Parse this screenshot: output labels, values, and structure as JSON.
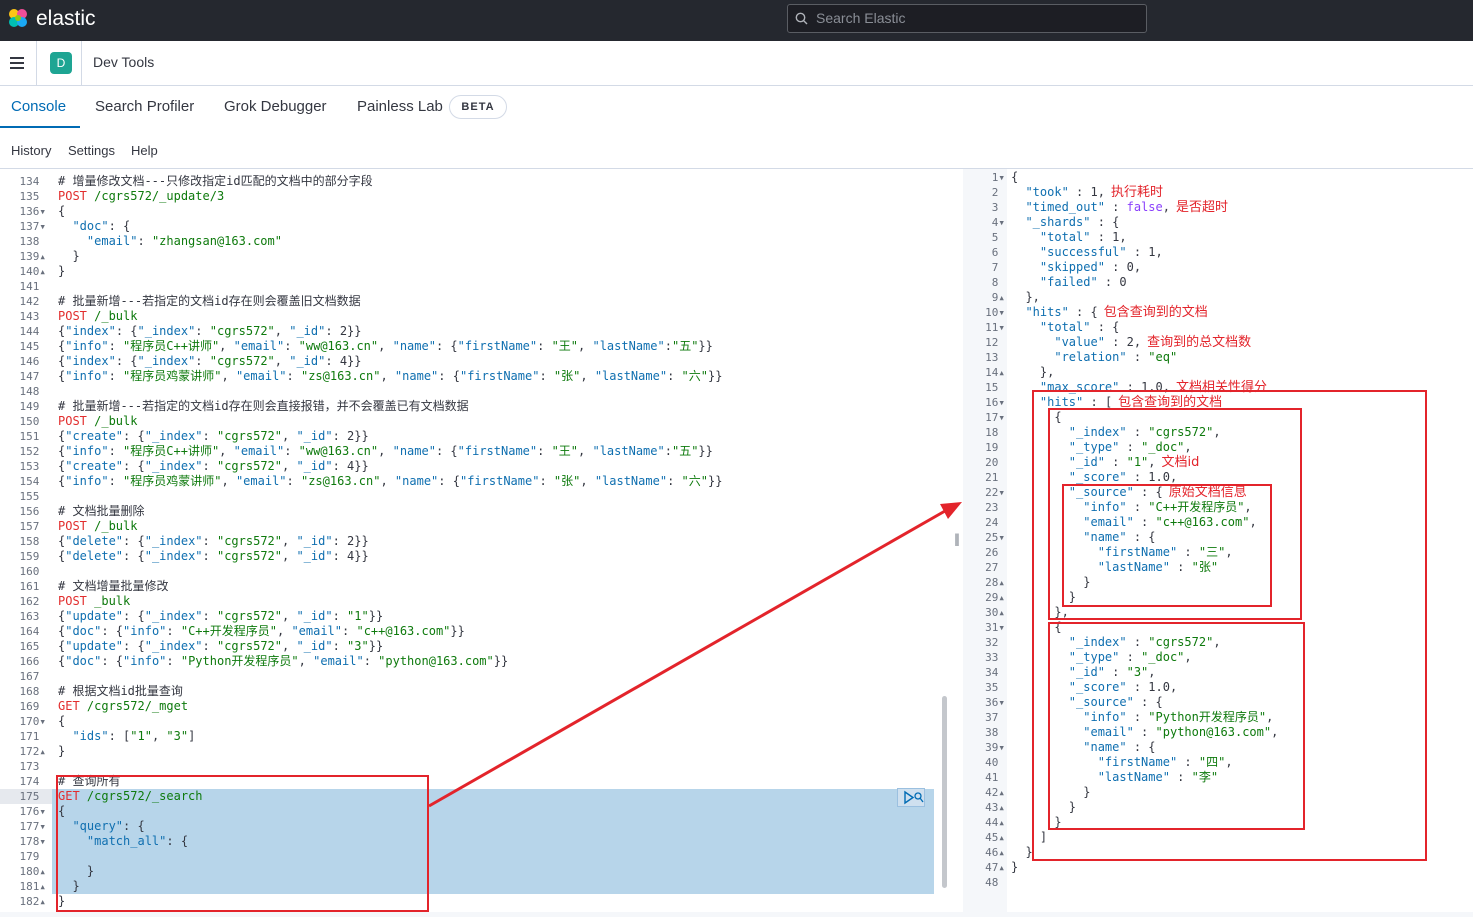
{
  "brand": {
    "name": "elastic"
  },
  "search": {
    "placeholder": "Search Elastic"
  },
  "header": {
    "space_initial": "D",
    "breadcrumb": "Dev Tools"
  },
  "tabs": [
    {
      "label": "Console",
      "active": true
    },
    {
      "label": "Search Profiler"
    },
    {
      "label": "Grok Debugger"
    },
    {
      "label": "Painless Lab",
      "badge": "BETA"
    }
  ],
  "menu": [
    "History",
    "Settings",
    "Help"
  ],
  "colors": {
    "accent": "#006bb4",
    "annotation": "#e3242b",
    "selection": "#b7d5ea",
    "keyword": "#e22d2d",
    "string": "#0e7a0d",
    "key": "#0f6fb0"
  },
  "editor": {
    "lines": [
      {
        "n": "134",
        "t": "# 增量修改文档---只修改指定id匹配的文档中的部分字段",
        "c": "comment"
      },
      {
        "n": "135",
        "t": "POST /cgrs572/_update/3",
        "c": "method"
      },
      {
        "n": "136",
        "t": "{",
        "f": "▾"
      },
      {
        "n": "137",
        "t": "  \"doc\": {",
        "f": "▾"
      },
      {
        "n": "138",
        "t": "    \"email\": \"zhangsan@163.com\""
      },
      {
        "n": "139",
        "t": "  }",
        "f": "▴"
      },
      {
        "n": "140",
        "t": "}",
        "f": "▴"
      },
      {
        "n": "141",
        "t": ""
      },
      {
        "n": "142",
        "t": "# 批量新增---若指定的文档id存在则会覆盖旧文档数据",
        "c": "comment"
      },
      {
        "n": "143",
        "t": "POST /_bulk",
        "c": "method"
      },
      {
        "n": "144",
        "t": "{\"index\": {\"_index\": \"cgrs572\", \"_id\": 2}}"
      },
      {
        "n": "145",
        "t": "{\"info\": \"程序员C++讲师\", \"email\": \"ww@163.cn\", \"name\": {\"firstName\": \"王\", \"lastName\":\"五\"}}"
      },
      {
        "n": "146",
        "t": "{\"index\": {\"_index\": \"cgrs572\", \"_id\": 4}}"
      },
      {
        "n": "147",
        "t": "{\"info\": \"程序员鸡蒙讲师\", \"email\": \"zs@163.cn\", \"name\": {\"firstName\": \"张\", \"lastName\": \"六\"}}"
      },
      {
        "n": "148",
        "t": ""
      },
      {
        "n": "149",
        "t": "# 批量新增---若指定的文档id存在则会直接报错，并不会覆盖已有文档数据",
        "c": "comment"
      },
      {
        "n": "150",
        "t": "POST /_bulk",
        "c": "method"
      },
      {
        "n": "151",
        "t": "{\"create\": {\"_index\": \"cgrs572\", \"_id\": 2}}"
      },
      {
        "n": "152",
        "t": "{\"info\": \"程序员C++讲师\", \"email\": \"ww@163.cn\", \"name\": {\"firstName\": \"王\", \"lastName\":\"五\"}}"
      },
      {
        "n": "153",
        "t": "{\"create\": {\"_index\": \"cgrs572\", \"_id\": 4}}"
      },
      {
        "n": "154",
        "t": "{\"info\": \"程序员鸡蒙讲师\", \"email\": \"zs@163.cn\", \"name\": {\"firstName\": \"张\", \"lastName\": \"六\"}}"
      },
      {
        "n": "155",
        "t": ""
      },
      {
        "n": "156",
        "t": "# 文档批量删除",
        "c": "comment"
      },
      {
        "n": "157",
        "t": "POST /_bulk",
        "c": "method"
      },
      {
        "n": "158",
        "t": "{\"delete\": {\"_index\": \"cgrs572\", \"_id\": 2}}"
      },
      {
        "n": "159",
        "t": "{\"delete\": {\"_index\": \"cgrs572\", \"_id\": 4}}"
      },
      {
        "n": "160",
        "t": ""
      },
      {
        "n": "161",
        "t": "# 文档增量批量修改",
        "c": "comment"
      },
      {
        "n": "162",
        "t": "POST _bulk",
        "c": "method"
      },
      {
        "n": "163",
        "t": "{\"update\": {\"_index\": \"cgrs572\", \"_id\": \"1\"}}"
      },
      {
        "n": "164",
        "t": "{\"doc\": {\"info\": \"C++开发程序员\", \"email\": \"c++@163.com\"}}"
      },
      {
        "n": "165",
        "t": "{\"update\": {\"_index\": \"cgrs572\", \"_id\": \"3\"}}"
      },
      {
        "n": "166",
        "t": "{\"doc\": {\"info\": \"Python开发程序员\", \"email\": \"python@163.com\"}}"
      },
      {
        "n": "167",
        "t": ""
      },
      {
        "n": "168",
        "t": "# 根据文档id批量查询",
        "c": "comment"
      },
      {
        "n": "169",
        "t": "GET /cgrs572/_mget",
        "c": "method"
      },
      {
        "n": "170",
        "t": "{",
        "f": "▾"
      },
      {
        "n": "171",
        "t": "  \"ids\": [\"1\", \"3\"]"
      },
      {
        "n": "172",
        "t": "}",
        "f": "▴"
      },
      {
        "n": "173",
        "t": ""
      },
      {
        "n": "174",
        "t": "# 查询所有",
        "c": "comment"
      },
      {
        "n": "175",
        "t": "GET /cgrs572/_search",
        "c": "method"
      },
      {
        "n": "176",
        "t": "{",
        "f": "▾"
      },
      {
        "n": "177",
        "t": "  \"query\": {",
        "f": "▾"
      },
      {
        "n": "178",
        "t": "    \"match_all\": {",
        "f": "▾"
      },
      {
        "n": "179",
        "t": "      "
      },
      {
        "n": "180",
        "t": "    }",
        "f": "▴"
      },
      {
        "n": "181",
        "t": "  }",
        "f": "▴"
      },
      {
        "n": "182",
        "t": "}",
        "f": "▴"
      }
    ]
  },
  "response": {
    "lines": [
      {
        "n": "1",
        "t": "{",
        "f": "▾"
      },
      {
        "n": "2",
        "t": "  \"took\" : 1,",
        "a": "执行耗时"
      },
      {
        "n": "3",
        "t": "  \"timed_out\" : false,",
        "a": "是否超时"
      },
      {
        "n": "4",
        "t": "  \"_shards\" : {",
        "f": "▾"
      },
      {
        "n": "5",
        "t": "    \"total\" : 1,"
      },
      {
        "n": "6",
        "t": "    \"successful\" : 1,"
      },
      {
        "n": "7",
        "t": "    \"skipped\" : 0,"
      },
      {
        "n": "8",
        "t": "    \"failed\" : 0"
      },
      {
        "n": "9",
        "t": "  },",
        "f": "▴"
      },
      {
        "n": "10",
        "t": "  \"hits\" : {",
        "f": "▾",
        "a": "包含查询到的文档"
      },
      {
        "n": "11",
        "t": "    \"total\" : {",
        "f": "▾"
      },
      {
        "n": "12",
        "t": "      \"value\" : 2,",
        "a": "查询到的总文档数"
      },
      {
        "n": "13",
        "t": "      \"relation\" : \"eq\""
      },
      {
        "n": "14",
        "t": "    },",
        "f": "▴"
      },
      {
        "n": "15",
        "t": "    \"max_score\" : 1.0,",
        "a": "文档相关性得分"
      },
      {
        "n": "16",
        "t": "    \"hits\" : [",
        "f": "▾",
        "a": "包含查询到的文档"
      },
      {
        "n": "17",
        "t": "      {",
        "f": "▾"
      },
      {
        "n": "18",
        "t": "        \"_index\" : \"cgrs572\","
      },
      {
        "n": "19",
        "t": "        \"_type\" : \"_doc\","
      },
      {
        "n": "20",
        "t": "        \"_id\" : \"1\",",
        "a": "文档id"
      },
      {
        "n": "21",
        "t": "        \"_score\" : 1.0,"
      },
      {
        "n": "22",
        "t": "        \"_source\" : {",
        "f": "▾",
        "a": "原始文档信息"
      },
      {
        "n": "23",
        "t": "          \"info\" : \"C++开发程序员\","
      },
      {
        "n": "24",
        "t": "          \"email\" : \"c++@163.com\","
      },
      {
        "n": "25",
        "t": "          \"name\" : {",
        "f": "▾"
      },
      {
        "n": "26",
        "t": "            \"firstName\" : \"三\","
      },
      {
        "n": "27",
        "t": "            \"lastName\" : \"张\""
      },
      {
        "n": "28",
        "t": "          }",
        "f": "▴"
      },
      {
        "n": "29",
        "t": "        }",
        "f": "▴"
      },
      {
        "n": "30",
        "t": "      },",
        "f": "▴"
      },
      {
        "n": "31",
        "t": "      {",
        "f": "▾"
      },
      {
        "n": "32",
        "t": "        \"_index\" : \"cgrs572\","
      },
      {
        "n": "33",
        "t": "        \"_type\" : \"_doc\","
      },
      {
        "n": "34",
        "t": "        \"_id\" : \"3\","
      },
      {
        "n": "35",
        "t": "        \"_score\" : 1.0,"
      },
      {
        "n": "36",
        "t": "        \"_source\" : {",
        "f": "▾"
      },
      {
        "n": "37",
        "t": "          \"info\" : \"Python开发程序员\","
      },
      {
        "n": "38",
        "t": "          \"email\" : \"python@163.com\","
      },
      {
        "n": "39",
        "t": "          \"name\" : {",
        "f": "▾"
      },
      {
        "n": "40",
        "t": "            \"firstName\" : \"四\","
      },
      {
        "n": "41",
        "t": "            \"lastName\" : \"李\""
      },
      {
        "n": "42",
        "t": "          }",
        "f": "▴"
      },
      {
        "n": "43",
        "t": "        }",
        "f": "▴"
      },
      {
        "n": "44",
        "t": "      }",
        "f": "▴"
      },
      {
        "n": "45",
        "t": "    ]",
        "f": "▴"
      },
      {
        "n": "46",
        "t": "  }",
        "f": "▴"
      },
      {
        "n": "47",
        "t": "}",
        "f": "▴"
      },
      {
        "n": "48",
        "t": ""
      }
    ]
  }
}
